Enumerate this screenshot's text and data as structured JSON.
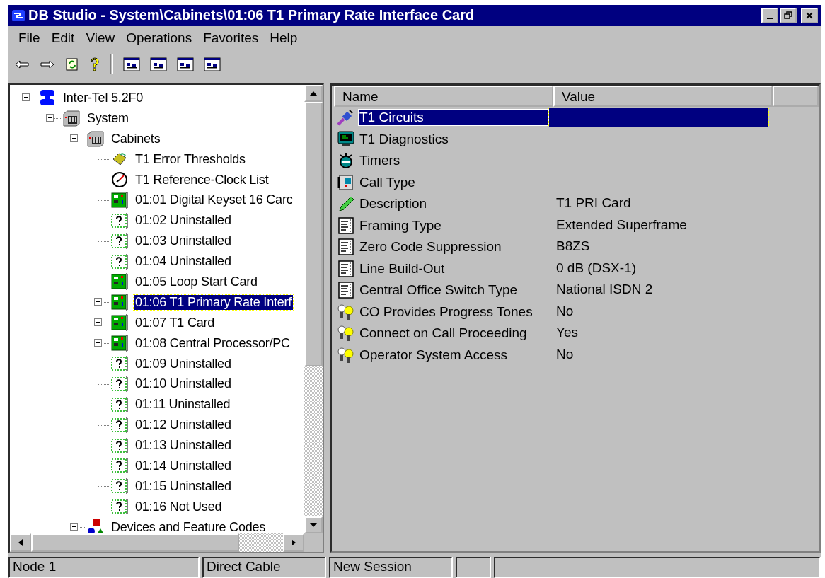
{
  "window": {
    "title": "DB Studio - System\\Cabinets\\01:06 T1 Primary Rate Interface Card"
  },
  "menu": [
    "File",
    "Edit",
    "View",
    "Operations",
    "Favorites",
    "Help"
  ],
  "tree": [
    {
      "label": "Inter-Tel 5.2F0",
      "kind": "network",
      "expanded": true,
      "selected": false,
      "children": [
        {
          "label": "System",
          "kind": "cabinet",
          "expanded": true,
          "selected": false,
          "children": [
            {
              "label": "Cabinets",
              "kind": "cabinet",
              "expanded": true,
              "selected": false,
              "children": [
                {
                  "label": "T1 Error Thresholds",
                  "kind": "thresholds",
                  "selected": false
                },
                {
                  "label": "T1 Reference-Clock List",
                  "kind": "clock",
                  "selected": false
                },
                {
                  "label": "01:01 Digital Keyset 16 Carc",
                  "kind": "card",
                  "selected": false
                },
                {
                  "label": "01:02 Uninstalled",
                  "kind": "uninstalled",
                  "selected": false
                },
                {
                  "label": "01:03 Uninstalled",
                  "kind": "uninstalled",
                  "selected": false
                },
                {
                  "label": "01:04 Uninstalled",
                  "kind": "uninstalled",
                  "selected": false
                },
                {
                  "label": "01:05 Loop Start Card",
                  "kind": "card",
                  "selected": false
                },
                {
                  "label": "01:06 T1 Primary Rate Interf",
                  "kind": "card",
                  "expanded": false,
                  "selected": true
                },
                {
                  "label": "01:07 T1 Card",
                  "kind": "card",
                  "expanded": false,
                  "selected": false
                },
                {
                  "label": "01:08 Central Processor/PC",
                  "kind": "card",
                  "expanded": false,
                  "selected": false
                },
                {
                  "label": "01:09 Uninstalled",
                  "kind": "uninstalled",
                  "selected": false
                },
                {
                  "label": "01:10 Uninstalled",
                  "kind": "uninstalled",
                  "selected": false
                },
                {
                  "label": "01:11 Uninstalled",
                  "kind": "uninstalled",
                  "selected": false
                },
                {
                  "label": "01:12 Uninstalled",
                  "kind": "uninstalled",
                  "selected": false
                },
                {
                  "label": "01:13 Uninstalled",
                  "kind": "uninstalled",
                  "selected": false
                },
                {
                  "label": "01:14 Uninstalled",
                  "kind": "uninstalled",
                  "selected": false
                },
                {
                  "label": "01:15 Uninstalled",
                  "kind": "uninstalled",
                  "selected": false
                },
                {
                  "label": "01:16 Not Used",
                  "kind": "uninstalled",
                  "selected": false
                }
              ]
            },
            {
              "label": "Devices and Feature Codes",
              "kind": "devices",
              "expanded": false,
              "selected": false
            }
          ]
        }
      ]
    }
  ],
  "list": {
    "columns": [
      "Name",
      "Value"
    ],
    "rows": [
      {
        "name": "T1 Circuits",
        "kind": "circuits",
        "selected": true
      },
      {
        "name": "T1 Diagnostics",
        "kind": "monitor",
        "selected": false
      },
      {
        "name": "Timers",
        "kind": "timer",
        "selected": false
      },
      {
        "name": "Call Type",
        "kind": "phone",
        "selected": false
      },
      {
        "name": "Description",
        "kind": "pen",
        "value": "T1 PRI Card",
        "selected": false
      },
      {
        "name": "Framing Type",
        "kind": "form",
        "value": "Extended Superframe",
        "selected": false
      },
      {
        "name": "Zero Code Suppression",
        "kind": "form",
        "value": "B8ZS",
        "selected": false
      },
      {
        "name": "Line Build-Out",
        "kind": "form",
        "value": "0 dB (DSX-1)",
        "selected": false
      },
      {
        "name": "Central Office Switch Type",
        "kind": "form",
        "value": "National ISDN 2",
        "selected": false
      },
      {
        "name": "CO Provides Progress Tones",
        "kind": "bulbs",
        "value": "No",
        "selected": false
      },
      {
        "name": "Connect on Call Proceeding",
        "kind": "bulbs",
        "value": "Yes",
        "selected": false
      },
      {
        "name": "Operator System Access",
        "kind": "bulbs",
        "value": "No",
        "selected": false
      }
    ]
  },
  "status_bar": [
    "Node 1",
    "Direct Cable",
    "New Session"
  ]
}
